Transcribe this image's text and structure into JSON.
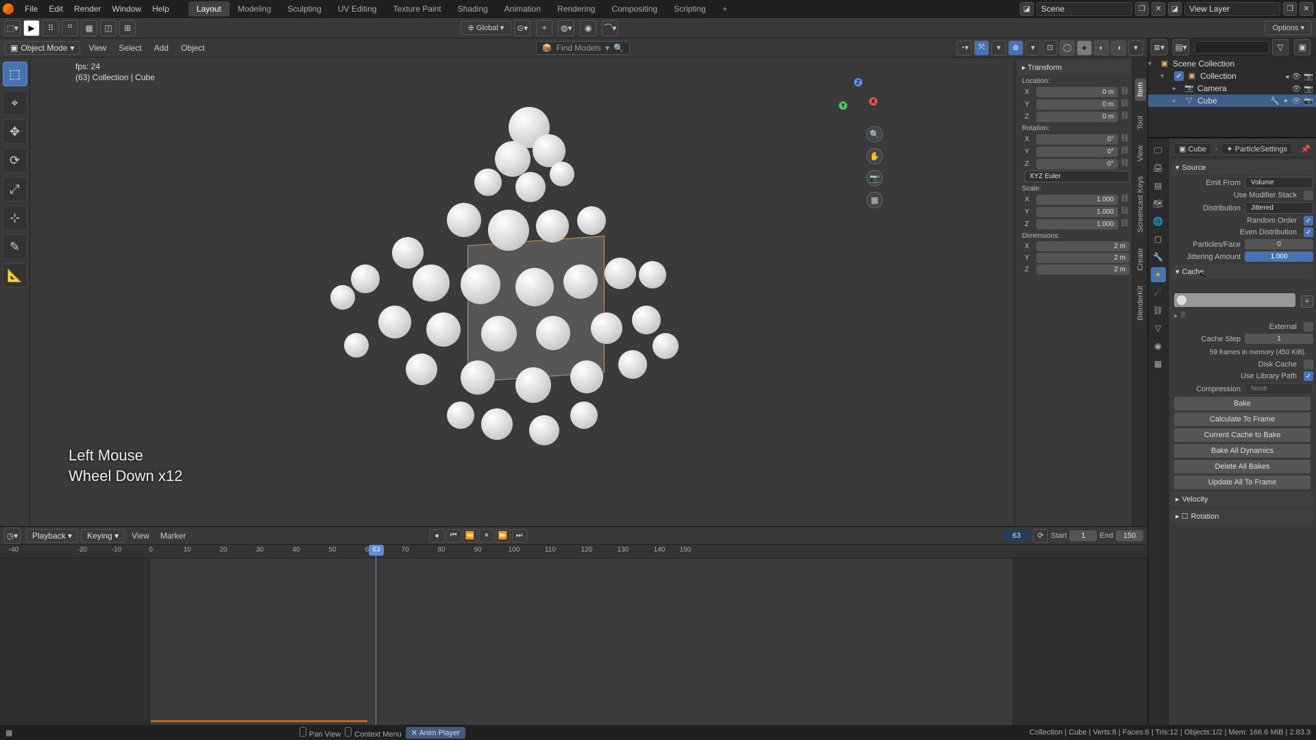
{
  "top_menu": {
    "file": "File",
    "edit": "Edit",
    "render": "Render",
    "window": "Window",
    "help": "Help"
  },
  "workspaces": {
    "tabs": [
      "Layout",
      "Modeling",
      "Sculpting",
      "UV Editing",
      "Texture Paint",
      "Shading",
      "Animation",
      "Rendering",
      "Compositing",
      "Scripting"
    ],
    "active_index": 0
  },
  "scene_header": {
    "scene_label": "Scene",
    "vlayer_label": "View Layer"
  },
  "tool_header": {
    "orientation": "Global",
    "options": "Options"
  },
  "vp_header": {
    "mode": "Object Mode",
    "menus": {
      "view": "View",
      "select": "Select",
      "add": "Add",
      "object": "Object"
    },
    "find": "Find Models"
  },
  "overlay": {
    "fps": "fps: 24",
    "info": "(63) Collection | Cube",
    "hint1": "Left Mouse",
    "hint2": "Wheel Down x12"
  },
  "vp_tabs": [
    "Item",
    "Tool",
    "View",
    "Screencast Keys",
    "Create",
    "BlenderKit"
  ],
  "npanel": {
    "transform": "Transform",
    "section": {
      "location": "Location:",
      "rotation": "Rotation:",
      "scale": "Scale:",
      "dimensions": "Dimensions:"
    },
    "axes": {
      "x": "X",
      "y": "Y",
      "z": "Z"
    },
    "loc": {
      "x": "0 m",
      "y": "0 m",
      "z": "0 m"
    },
    "rot": {
      "x": "0°",
      "y": "0°",
      "z": "0°"
    },
    "rot_mode": "XYZ Euler",
    "scl": {
      "x": "1.000",
      "y": "1.000",
      "z": "1.000"
    },
    "dim": {
      "x": "2 m",
      "y": "2 m",
      "z": "2 m"
    }
  },
  "outliner": {
    "root": "Scene Collection",
    "coll": "Collection",
    "camera": "Camera",
    "cube": "Cube"
  },
  "props_breadcrumb": {
    "object": "Cube",
    "datablock": "ParticleSettings"
  },
  "source": {
    "head": "Source",
    "emit_from_lbl": "Emit From",
    "emit_from": "Volume",
    "use_mod_lbl": "Use Modifier Stack",
    "dist_lbl": "Distribution",
    "dist": "Jittered",
    "rand_lbl": "Random Order",
    "even_lbl": "Even Distribution",
    "pface_lbl": "Particles/Face",
    "pface": "0",
    "jitter_lbl": "Jittering Amount",
    "jitter": "1.000"
  },
  "cache": {
    "head": "Cache",
    "external_lbl": "External",
    "step_lbl": "Cache Step",
    "step": "1",
    "info": "59 frames in memory (450 KiB).",
    "disk_lbl": "Disk Cache",
    "lib_lbl": "Use Library Path",
    "comp_lbl": "Compression",
    "comp": "None",
    "btns": [
      "Bake",
      "Calculate To Frame",
      "Current Cache to Bake",
      "Bake All Dynamics",
      "Delete All Bakes",
      "Update All To Frame"
    ]
  },
  "collapsed_panels": {
    "velocity": "Velocity",
    "rotation": "Rotation"
  },
  "timeline": {
    "playback": "Playback",
    "keying": "Keying",
    "view": "View",
    "marker": "Marker",
    "current": "63",
    "start_lbl": "Start",
    "start": "1",
    "end_lbl": "End",
    "end": "150",
    "ticks": [
      "-40",
      "-20",
      "-10",
      "0",
      "10",
      "20",
      "30",
      "40",
      "50",
      "60",
      "70",
      "80",
      "90",
      "100",
      "110",
      "120",
      "130",
      "140",
      "150"
    ]
  },
  "status": {
    "pan": "Pan View",
    "context": "Context Menu",
    "anim": "Anim Player",
    "right": "Collection | Cube | Verts:8 | Faces:6 | Tris:12 | Objects:1/2 | Mem: 166.6 MiB | 2.83.3"
  }
}
